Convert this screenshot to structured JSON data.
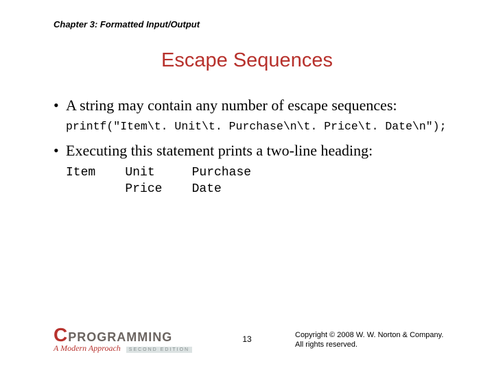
{
  "chapter_header": "Chapter 3: Formatted Input/Output",
  "title": "Escape Sequences",
  "bullets": [
    {
      "text": "A string may contain any number of escape sequences:",
      "code": "printf(\"Item\\t. Unit\\t. Purchase\\n\\t. Price\\t. Date\\n\");"
    },
    {
      "text": "Executing this statement prints a two-line heading:",
      "output": "Item    Unit     Purchase\n        Price    Date"
    }
  ],
  "page_number": "13",
  "logo": {
    "c": "C",
    "word": "PROGRAMMING",
    "subtitle": "A Modern Approach",
    "edition": "SECOND EDITION"
  },
  "copyright": "Copyright © 2008 W. W. Norton & Company.\nAll rights reserved."
}
